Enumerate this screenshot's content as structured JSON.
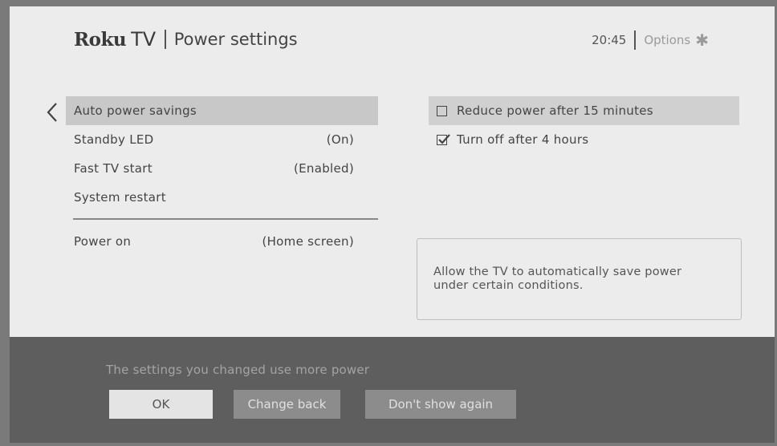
{
  "header": {
    "brand_roku": "Roku",
    "brand_tv": "TV",
    "title": "Power settings",
    "clock": "20:45",
    "options_label": "Options",
    "options_icon": "✱"
  },
  "menu": {
    "items": [
      {
        "label": "Auto power savings",
        "value": ""
      },
      {
        "label": "Standby LED",
        "value": "(On)"
      },
      {
        "label": "Fast TV start",
        "value": "(Enabled)"
      },
      {
        "label": "System restart",
        "value": ""
      }
    ],
    "secondary": [
      {
        "label": "Power on",
        "value": "(Home screen)"
      }
    ]
  },
  "options": {
    "items": [
      {
        "label": "Reduce power after 15 minutes",
        "checked": false
      },
      {
        "label": "Turn off after 4 hours",
        "checked": true
      }
    ]
  },
  "description": {
    "line1": "Allow the TV to automatically save power",
    "line2": "under certain conditions."
  },
  "banner": {
    "message": "The settings you changed use more power",
    "ok_label": "OK",
    "change_back_label": "Change back",
    "dont_show_label": "Don't show again"
  },
  "colors": {
    "screen_bg": "#ececec",
    "banner_bg": "#5e5e5e",
    "selected_bg": "#c8c8c8"
  },
  "icons": {
    "back": "chevron-left-icon",
    "options": "asterisk-icon",
    "checkbox_empty": "checkbox-empty-icon",
    "checkbox_checked": "checkbox-checked-icon"
  }
}
